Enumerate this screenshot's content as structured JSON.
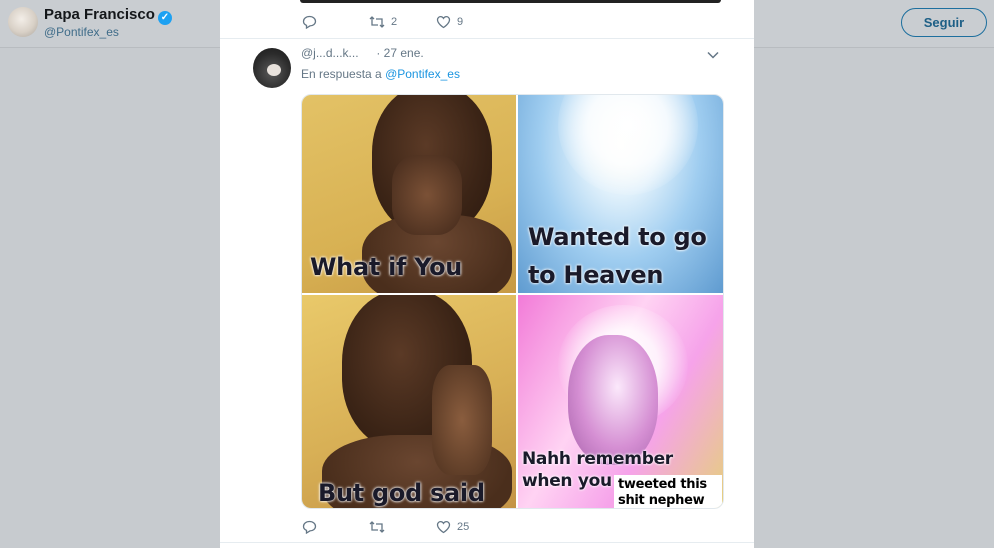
{
  "profile_bar": {
    "name": "Papa Francisco",
    "handle": "@Pontifex_es",
    "verified_icon": "✓",
    "follow_label": "Seguir"
  },
  "prev_tweet_actions": {
    "reply_count": "",
    "retweet_count": "2",
    "like_count": "9"
  },
  "tweet": {
    "handle_partial": "@j...d...k...",
    "date": "· 27 ene.",
    "reply_prefix": "En respuesta a",
    "reply_handle": "@Pontifex_es",
    "meme": {
      "panel1": "What if You",
      "panel2_line1": "Wanted to go",
      "panel2_line2": "to Heaven",
      "panel3": "But god said",
      "panel4_line1": "Nahh remember",
      "panel4_line2": "when you",
      "panel4_box_line1": "tweeted this",
      "panel4_box_line2": "shit nephew"
    },
    "actions": {
      "reply_count": "",
      "retweet_count": "",
      "like_count": "25"
    }
  },
  "colors": {
    "link": "#1b95e0",
    "verified": "#1da1f2",
    "muted": "#657786"
  }
}
